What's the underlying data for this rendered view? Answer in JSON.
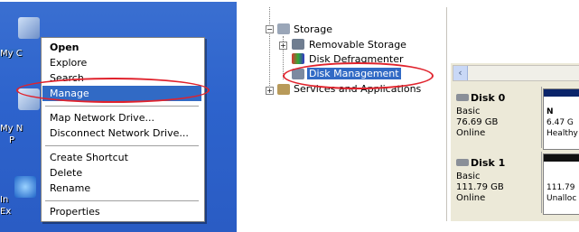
{
  "desktop": {
    "icon_labels": [
      "My C",
      "My N",
      "P",
      "In",
      "Ex"
    ]
  },
  "context_menu": {
    "items": [
      {
        "label": "Open",
        "bold": true
      },
      {
        "label": "Explore"
      },
      {
        "label": "Search"
      },
      {
        "label": "Manage",
        "highlighted": true
      },
      {
        "label": "Map Network Drive..."
      },
      {
        "label": "Disconnect Network Drive..."
      },
      {
        "label": "Create Shortcut"
      },
      {
        "label": "Delete"
      },
      {
        "label": "Rename"
      },
      {
        "label": "Properties"
      }
    ]
  },
  "tree": {
    "items": [
      {
        "label": "Storage"
      },
      {
        "label": "Removable Storage"
      },
      {
        "label": "Disk Defragmenter"
      },
      {
        "label": "Disk Management",
        "selected": true
      },
      {
        "label": "Services and Applications"
      }
    ]
  },
  "disks": [
    {
      "name": "Disk 0",
      "type": "Basic",
      "size": "76.69 GB",
      "status": "Online",
      "partition": {
        "line1": "N",
        "line2": "6.47 G",
        "line3": "Healthy"
      }
    },
    {
      "name": "Disk 1",
      "type": "Basic",
      "size": "111.79 GB",
      "status": "Online",
      "partition": {
        "line1": "111.79",
        "line2": "Unalloc"
      }
    }
  ],
  "colors": {
    "selection": "#316ac5",
    "annotation": "#e0222c",
    "partition_primary": "#0a246a"
  }
}
